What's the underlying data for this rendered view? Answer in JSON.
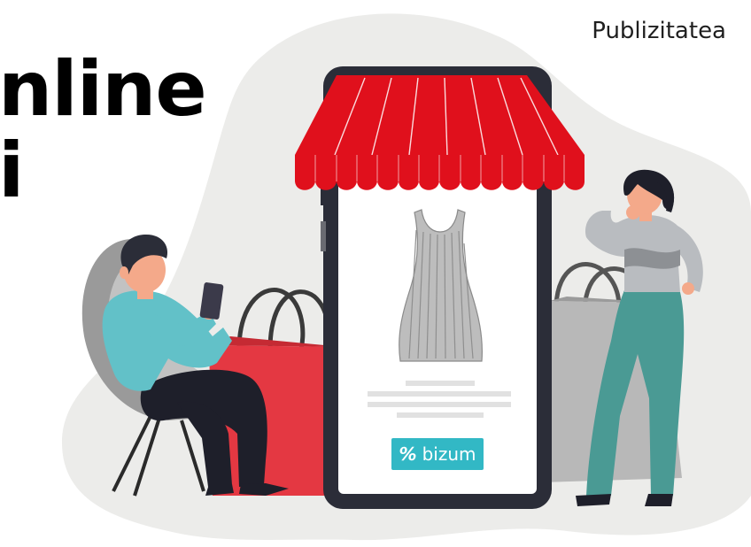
{
  "ad": {
    "label": "Publizitatea"
  },
  "headline": {
    "line1": "nline",
    "line2": "i"
  },
  "product": {
    "name": "dress"
  },
  "payment": {
    "brand": "bizum",
    "icon": "bizum-z-icon"
  },
  "colors": {
    "blob_bg": "#ececea",
    "awning_red": "#e0101c",
    "phone_frame": "#2b2d38",
    "bizum": "#32b8c5",
    "bag_red": "#e43842",
    "bag_gray": "#b8b8b8",
    "shirt_teal": "#62c1c8",
    "pants_teal": "#4a9a94"
  }
}
